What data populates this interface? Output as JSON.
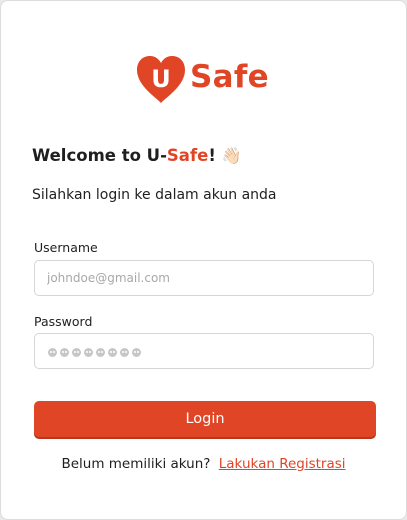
{
  "brand": {
    "logo_letter": "U",
    "logo_text": "Safe",
    "accent_color": "#e04525"
  },
  "welcome": {
    "prefix": "Welcome to U-",
    "accent": "Safe",
    "suffix": "!",
    "emoji": "👋🏻",
    "emoji_icon": "waving-hand-icon"
  },
  "subtitle": "Silahkan login ke dalam akun anda",
  "form": {
    "username_label": "Username",
    "username_placeholder": "johndoe@gmail.com",
    "username_value": "",
    "password_label": "Password",
    "password_mask_count": 8,
    "login_label": "Login"
  },
  "register": {
    "prompt": "Belum memiliki akun?",
    "link_label": "Lakukan Registrasi"
  }
}
